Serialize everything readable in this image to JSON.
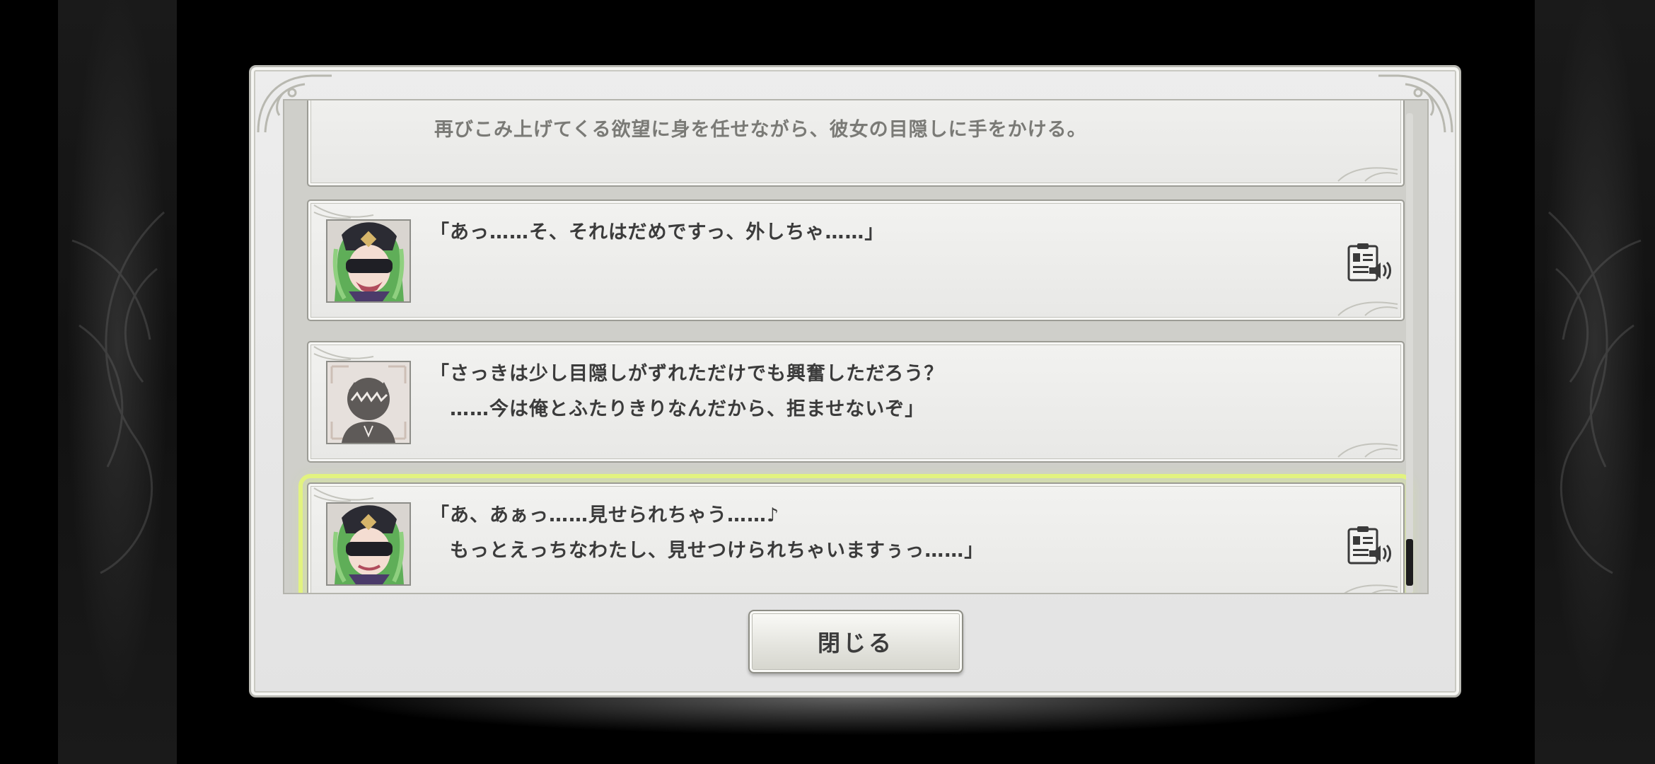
{
  "log_entries": [
    {
      "speaker": "narration",
      "lines": [
        "再びこみ上げてくる欲望に身を任せながら、彼女の目隠しに手をかける。"
      ]
    },
    {
      "speaker": "green-haired-girl",
      "lines": [
        "「あっ……そ、それはだめですっ、外しちゃ……」"
      ],
      "voice_icon": "voice-replay-icon"
    },
    {
      "speaker": "protagonist",
      "lines": [
        "「さっきは少し目隠しがずれただけでも興奮しただろう？",
        "　……今は俺とふたりきりなんだから、拒ませないぞ」"
      ]
    },
    {
      "speaker": "green-haired-girl",
      "lines": [
        "「あ、あぁっ……見せられちゃう……♪",
        "　もっとえっちなわたし、見せつけられちゃいますぅっ……」"
      ],
      "voice_icon": "voice-replay-icon",
      "highlighted": true
    }
  ],
  "close_button": {
    "label": "閉じる"
  },
  "colors": {
    "highlight": "#e2f37f",
    "panel": "#e8e8e6",
    "text": "#3b3b3b",
    "narration_text": "#7a7a76",
    "hair": "#6fbf63"
  }
}
